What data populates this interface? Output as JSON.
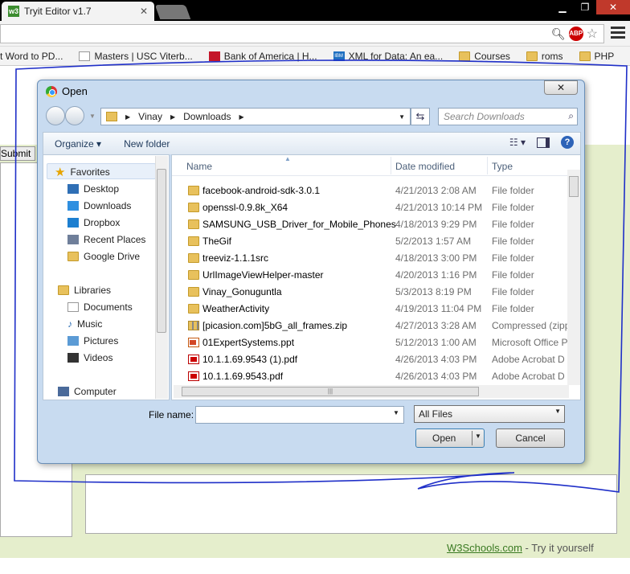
{
  "browser": {
    "tab_title": "Tryit Editor v1.7",
    "tab_favicon": "w3",
    "abp_label": "ABP",
    "bookmarks": [
      {
        "label": "t Word to PD...",
        "icon": "page-icon"
      },
      {
        "label": "Masters | USC Viterb...",
        "icon": "page-icon"
      },
      {
        "label": "Bank of America | H...",
        "icon": "bank-icon"
      },
      {
        "label": "XML for Data: An ea...",
        "icon": "ibm-icon"
      },
      {
        "label": "Courses",
        "icon": "folder-icon"
      },
      {
        "label": "roms",
        "icon": "folder-icon"
      },
      {
        "label": "PHP",
        "icon": "folder-icon"
      }
    ],
    "bookmarks_overflow": "»"
  },
  "page": {
    "submit_label": "Submit",
    "footer_brand": "W3Schools.com",
    "footer_tail": " - Try it yourself"
  },
  "dialog": {
    "title": "Open",
    "breadcrumb": [
      "Vinay",
      "Downloads"
    ],
    "search_placeholder": "Search Downloads",
    "organize_label": "Organize",
    "new_folder_label": "New folder",
    "nav": {
      "favorites_label": "Favorites",
      "favorites": [
        "Desktop",
        "Downloads",
        "Dropbox",
        "Recent Places",
        "Google Drive"
      ],
      "libraries_label": "Libraries",
      "libraries": [
        "Documents",
        "Music",
        "Pictures",
        "Videos"
      ],
      "computer_label": "Computer"
    },
    "columns": {
      "name": "Name",
      "date": "Date modified",
      "type": "Type"
    },
    "files": [
      {
        "name": "facebook-android-sdk-3.0.1",
        "date": "4/21/2013 2:08 AM",
        "type": "File folder",
        "icon": "folder"
      },
      {
        "name": "openssl-0.9.8k_X64",
        "date": "4/21/2013 10:14 PM",
        "type": "File folder",
        "icon": "folder"
      },
      {
        "name": "SAMSUNG_USB_Driver_for_Mobile_Phones",
        "date": "4/18/2013 9:29 PM",
        "type": "File folder",
        "icon": "folder"
      },
      {
        "name": "TheGif",
        "date": "5/2/2013 1:57 AM",
        "type": "File folder",
        "icon": "folder"
      },
      {
        "name": "treeviz-1.1.1src",
        "date": "4/18/2013 3:00 PM",
        "type": "File folder",
        "icon": "folder"
      },
      {
        "name": "UrlImageViewHelper-master",
        "date": "4/20/2013 1:16 PM",
        "type": "File folder",
        "icon": "folder"
      },
      {
        "name": "Vinay_Gonuguntla",
        "date": "5/3/2013 8:19 PM",
        "type": "File folder",
        "icon": "folder"
      },
      {
        "name": "WeatherActivity",
        "date": "4/19/2013 11:04 PM",
        "type": "File folder",
        "icon": "folder"
      },
      {
        "name": "[picasion.com]5bG_all_frames.zip",
        "date": "4/27/2013 3:28 AM",
        "type": "Compressed (zipp",
        "icon": "zip"
      },
      {
        "name": "01ExpertSystems.ppt",
        "date": "5/12/2013 1:00 AM",
        "type": "Microsoft Office P",
        "icon": "ppt"
      },
      {
        "name": "10.1.1.69.9543 (1).pdf",
        "date": "4/26/2013 4:03 PM",
        "type": "Adobe Acrobat D",
        "icon": "pdf"
      },
      {
        "name": "10.1.1.69.9543.pdf",
        "date": "4/26/2013 4:03 PM",
        "type": "Adobe Acrobat D",
        "icon": "pdf"
      }
    ],
    "file_name_label": "File name:",
    "file_name_value": "",
    "filter_value": "All Files",
    "open_label": "Open",
    "cancel_label": "Cancel"
  },
  "colors": {
    "scribble": "#1f2fc8",
    "page_green": "#e5eecc",
    "dialog_frame": "#c8dbf0"
  }
}
